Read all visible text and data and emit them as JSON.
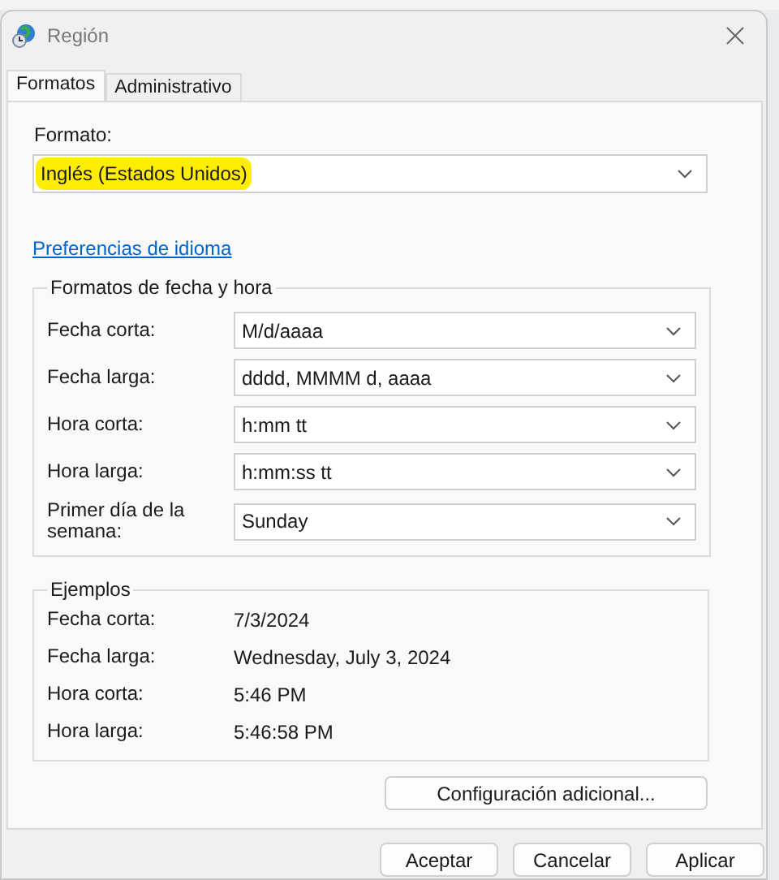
{
  "window": {
    "title": "Región"
  },
  "tabs": [
    {
      "label": "Formatos",
      "selected": true
    },
    {
      "label": "Administrativo",
      "selected": false
    }
  ],
  "format": {
    "label": "Formato:",
    "value": "Inglés (Estados Unidos)",
    "highlighted": true
  },
  "language_link": "Preferencias de idioma",
  "date_time_formats": {
    "title": "Formatos de fecha y hora",
    "rows": [
      {
        "label": "Fecha corta:",
        "value": "M/d/aaaa"
      },
      {
        "label": "Fecha larga:",
        "value": "dddd, MMMM d, aaaa"
      },
      {
        "label": "Hora corta:",
        "value": "h:mm tt"
      },
      {
        "label": "Hora larga:",
        "value": "h:mm:ss tt"
      },
      {
        "label": "Primer día de la semana:",
        "value": "Sunday"
      }
    ]
  },
  "examples": {
    "title": "Ejemplos",
    "rows": [
      {
        "label": "Fecha corta:",
        "value": "7/3/2024"
      },
      {
        "label": "Fecha larga:",
        "value": "Wednesday, July 3, 2024"
      },
      {
        "label": "Hora corta:",
        "value": "5:46 PM"
      },
      {
        "label": "Hora larga:",
        "value": "5:46:58 PM"
      }
    ]
  },
  "additional_button": "Configuración adicional...",
  "buttons": [
    "Aceptar",
    "Cancelar",
    "Aplicar"
  ]
}
